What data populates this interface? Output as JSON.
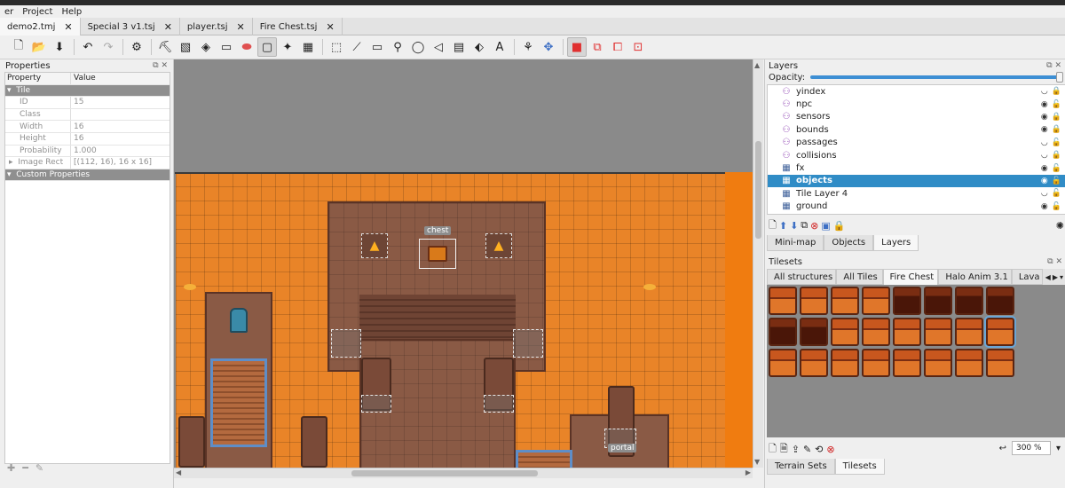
{
  "menu": [
    "er",
    "Project",
    "Help"
  ],
  "tabs": [
    {
      "label": "demo2.tmj",
      "active": true
    },
    {
      "label": "Special 3 v1.tsj",
      "active": false
    },
    {
      "label": "player.tsj",
      "active": false
    },
    {
      "label": "Fire Chest.tsj",
      "active": false
    }
  ],
  "tab_close": "✕",
  "properties": {
    "title": "Properties",
    "headers": [
      "Property",
      "Value"
    ],
    "group_tile": "Tile",
    "rows": [
      {
        "name": "ID",
        "value": "15"
      },
      {
        "name": "Class",
        "value": ""
      },
      {
        "name": "Width",
        "value": "16"
      },
      {
        "name": "Height",
        "value": "16"
      },
      {
        "name": "Probability",
        "value": "1.000"
      },
      {
        "name": "Image Rect",
        "value": "[(112, 16), 16 x 16]"
      }
    ],
    "group_custom": "Custom Properties"
  },
  "map": {
    "chest_label": "chest",
    "portal_label": "portal"
  },
  "layers_panel": {
    "title": "Layers",
    "opacity_label": "Opacity:",
    "opacity": 1.0,
    "layers": [
      {
        "name": "yindex",
        "kind": "object",
        "visible": false,
        "locked": true
      },
      {
        "name": "npc",
        "kind": "object",
        "visible": true,
        "locked": false
      },
      {
        "name": "sensors",
        "kind": "object",
        "visible": true,
        "locked": true
      },
      {
        "name": "bounds",
        "kind": "object",
        "visible": true,
        "locked": true
      },
      {
        "name": "passages",
        "kind": "object",
        "visible": false,
        "locked": false
      },
      {
        "name": "collisions",
        "kind": "object",
        "visible": false,
        "locked": true
      },
      {
        "name": "fx",
        "kind": "tile",
        "visible": true,
        "locked": false
      },
      {
        "name": "objects",
        "kind": "tile",
        "visible": true,
        "locked": false,
        "selected": true
      },
      {
        "name": "Tile Layer 4",
        "kind": "tile",
        "visible": false,
        "locked": false
      },
      {
        "name": "ground",
        "kind": "tile",
        "visible": true,
        "locked": false
      }
    ],
    "tabs": [
      "Mini-map",
      "Objects",
      "Layers"
    ]
  },
  "tilesets_panel": {
    "title": "Tilesets",
    "tabs": [
      "All structures",
      "All Tiles",
      "Fire Chest",
      "Halo Anim 3.1",
      "Lava t"
    ],
    "active_tab": "Fire Chest",
    "zoom": "300 %",
    "bottom_tabs": [
      "Terrain Sets",
      "Tilesets"
    ]
  },
  "colors": {
    "accent": "#308cc6",
    "map_orange": "#e98428",
    "floor_brown": "#8a5a45"
  }
}
